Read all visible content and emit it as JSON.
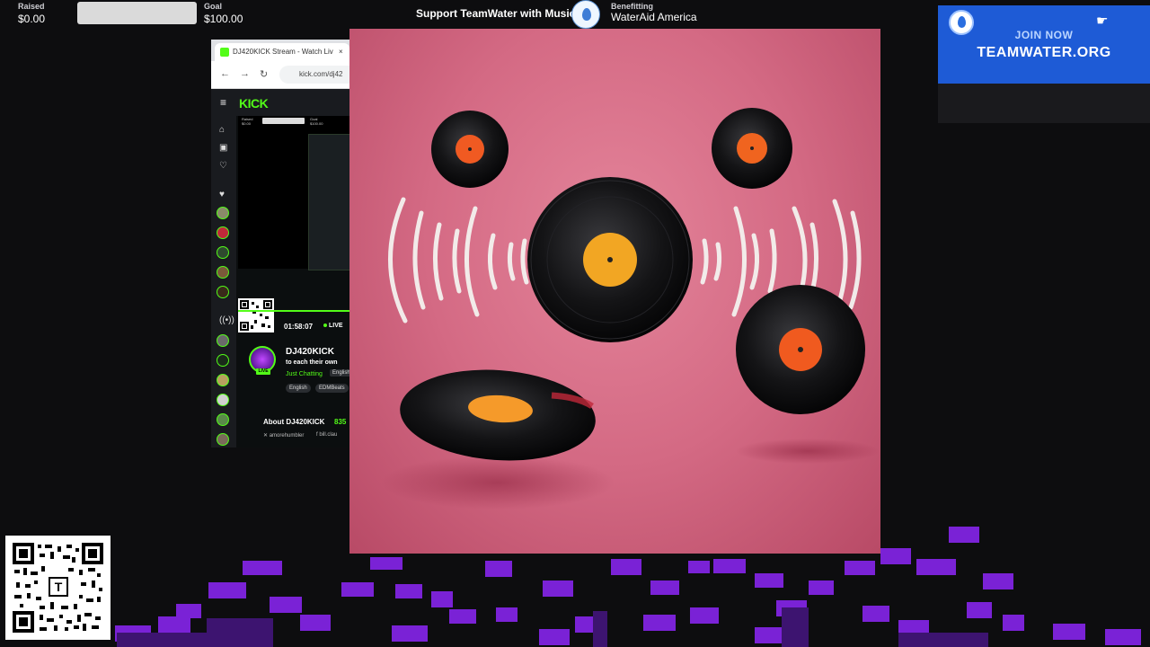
{
  "topbar": {
    "raised_label": "Raised",
    "raised_value": "$0.00",
    "goal_label": "Goal",
    "goal_value": "$100.00",
    "progress_percent": 0,
    "support_text": "Support TeamWater with Music",
    "benefit_label": "Benefitting",
    "benefit_value": "WaterAid America",
    "accent_color": "#3fa9f5"
  },
  "banner": {
    "join_text": "JOIN NOW",
    "site_text": "TEAMWATER.ORG",
    "background_color": "#1e5bd6"
  },
  "browser": {
    "tab_title": "DJ420KICK Stream - Watch Liv",
    "close_glyph": "×",
    "url": "kick.com/dj42",
    "back_glyph": "←",
    "forward_glyph": "→",
    "reload_glyph": "↻",
    "kick": {
      "logo": "KICK",
      "menu_glyph": "≡",
      "brand_color": "#53fc18",
      "stream_time": "01:58:07",
      "live_text": "LIVE",
      "channel_name": "DJ420KICK",
      "subtitle": "to each their own",
      "category": "Just Chatting",
      "language": "English",
      "tags": [
        "English",
        "EDMBeats"
      ],
      "live_badge": "LIVE",
      "about_title": "About DJ420KICK",
      "followers": "835",
      "socials": [
        "amorehumbler",
        "bill.clau"
      ],
      "mini_raised_label": "Raised",
      "mini_raised_value": "$0.00",
      "mini_goal_label": "Goal",
      "mini_goal_value": "$100.00"
    }
  },
  "artwork": {
    "description_icon": "vinyl-records-icon"
  }
}
